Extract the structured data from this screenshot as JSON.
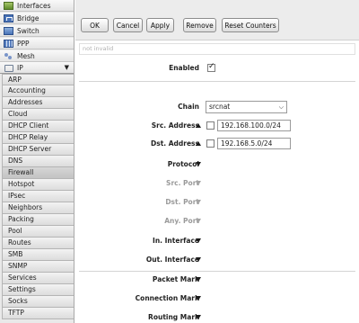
{
  "sidebar": {
    "top_items": [
      {
        "label": "Interfaces",
        "icon": "interfaces-icon"
      },
      {
        "label": "Bridge",
        "icon": "bridge-icon"
      },
      {
        "label": "Switch",
        "icon": "switch-icon"
      },
      {
        "label": "PPP",
        "icon": "ppp-icon"
      },
      {
        "label": "Mesh",
        "icon": "mesh-icon"
      },
      {
        "label": "IP",
        "icon": "ip-icon"
      }
    ],
    "ip_expand_arrow": "▼",
    "submenu": [
      "ARP",
      "Accounting",
      "Addresses",
      "Cloud",
      "DHCP Client",
      "DHCP Relay",
      "DHCP Server",
      "DNS",
      "Firewall",
      "Hotspot",
      "IPsec",
      "Neighbors",
      "Packing",
      "Pool",
      "Routes",
      "SMB",
      "SNMP",
      "Services",
      "Settings",
      "Socks",
      "TFTP"
    ],
    "active_submenu": "Firewall"
  },
  "toolbar": {
    "ok_label": "OK",
    "cancel_label": "Cancel",
    "apply_label": "Apply",
    "remove_label": "Remove",
    "reset_counters_label": "Reset Counters"
  },
  "status_text": "not invalid",
  "form": {
    "enabled_label": "Enabled",
    "enabled_checked": true,
    "chain_label": "Chain",
    "chain_value": "srcnat",
    "src_address_label": "Src. Address",
    "src_address_value": "192.168.100.0/24",
    "dst_address_label": "Dst. Address",
    "dst_address_value": "192.168.5.0/24",
    "protocol_label": "Protocol",
    "src_port_label": "Src. Port",
    "dst_port_label": "Dst. Port",
    "any_port_label": "Any. Port",
    "in_interface_label": "In. Interface",
    "out_interface_label": "Out. Interface",
    "packet_mark_label": "Packet Mark",
    "connection_mark_label": "Connection Mark",
    "routing_mark_label": "Routing Mark"
  }
}
